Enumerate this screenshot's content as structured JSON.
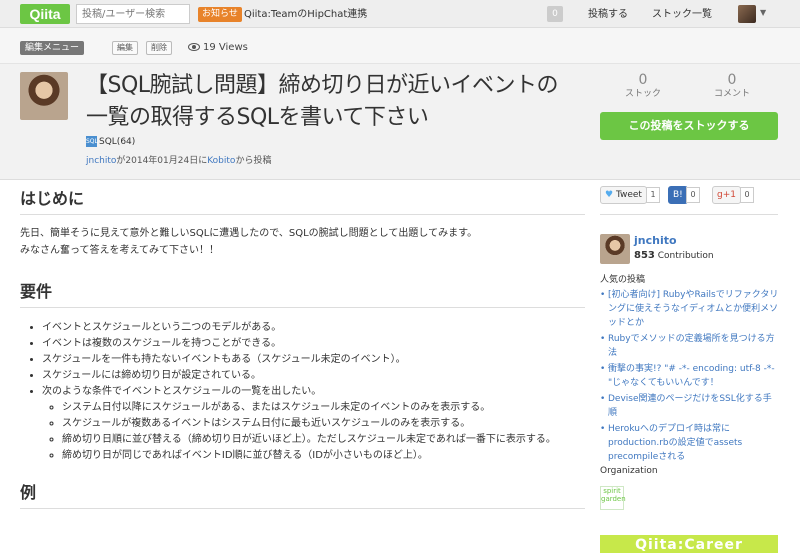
{
  "nav": {
    "logo": "Qiita",
    "search_placeholder": "投稿/ユーザー検索",
    "notice_badge": "お知らせ",
    "notice_text": "Qiita:TeamのHipChat連携",
    "count": "0",
    "post_link": "投稿する",
    "stock_list_link": "ストック一覧"
  },
  "editbar": {
    "edit_menu": "編集メニュー",
    "edit": "編集",
    "delete": "削除",
    "views": "19 Views"
  },
  "article": {
    "title": "【SQL腕試し問題】締め切り日が近いイベントの一覧の取得するSQLを書いて下さい",
    "tag": "SQL(64)",
    "tag_icon": "SQL",
    "posted": {
      "author": "jnchito",
      "date_text": "が2014年01月24日に",
      "via": "Kobito",
      "suffix": "から投稿"
    },
    "stock_count": "0",
    "stock_label": "ストック",
    "comment_count": "0",
    "comment_label": "コメント",
    "stock_button": "この投稿をストックする"
  },
  "content": {
    "h_intro": "はじめに",
    "intro_line1": "先日、簡単そうに見えて意外と難しいSQLに遭遇したので、SQLの腕試し問題として出題してみます。",
    "intro_line2": "みなさん奮って答えを考えてみて下さい！！",
    "h_requirements": "要件",
    "requirements": [
      "イベントとスケジュールという二つのモデルがある。",
      "イベントは複数のスケジュールを持つことができる。",
      "スケジュールを一件も持たないイベントもある（スケジュール未定のイベント）。",
      "スケジュールには締め切り日が設定されている。",
      "次のような条件でイベントとスケジュールの一覧を出したい。"
    ],
    "sub_requirements": [
      "システム日付以降にスケジュールがある、またはスケジュール未定のイベントのみを表示する。",
      "スケジュールが複数あるイベントはシステム日付に最も近いスケジュールのみを表示する。",
      "締め切り日順に並び替える（締め切り日が近いほど上）。ただしスケジュール未定であれば一番下に表示する。",
      "締め切り日が同じであればイベントID順に並び替える（IDが小さいものほど上）。"
    ],
    "h_example": "例"
  },
  "sidebar": {
    "tweet": "Tweet",
    "tweet_count": "1",
    "hatena": "B!",
    "hatena_count": "0",
    "gplus": "+1",
    "gplus_count": "0",
    "author_name": "jnchito",
    "contribution_num": "853",
    "contribution_label": "Contribution",
    "popular_heading": "人気の投稿",
    "popular": [
      "[初心者向け] RubyやRailsでリファクタリングに使えそうなイディオムとか便利メソッドとか",
      "Rubyでメソッドの定義場所を見つける方法",
      "衝撃の事実!? \"# -*- encoding: utf-8 -*-\"じゃなくてもいいんです！",
      "Devise関連のページだけをSSL化する手順",
      "Herokuへのデプロイ時は常にproduction.rbの設定値でassets precompileされる"
    ],
    "org_heading": "Organization",
    "org_logo_text": "spirit garden",
    "career": "Qiita:Career"
  },
  "colors": {
    "brand_green": "#6cc644",
    "link_blue": "#4078c0",
    "notice_orange": "#e8832a"
  }
}
